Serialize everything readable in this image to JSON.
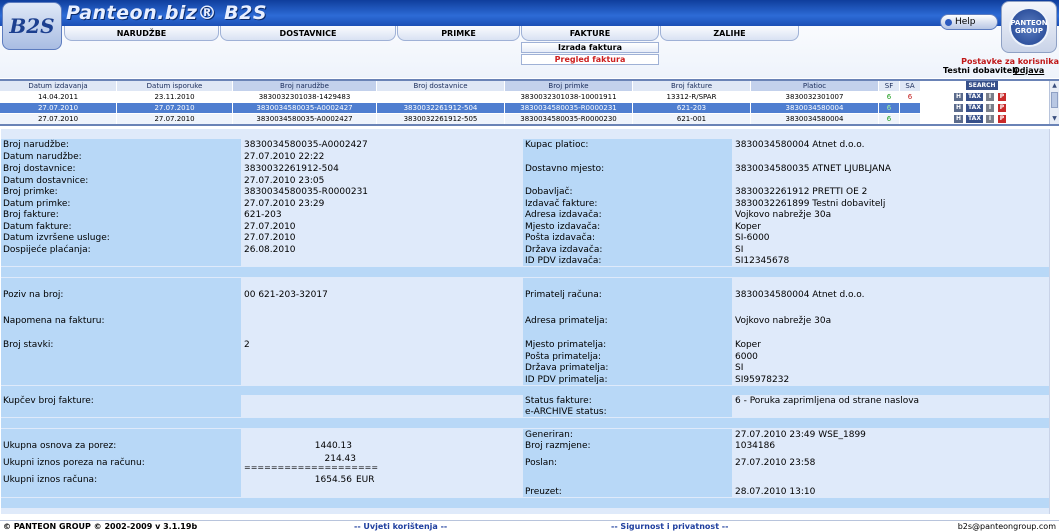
{
  "header": {
    "logo_text": "B2S",
    "brand_title": "Panteon.biz® B2S",
    "help_label": "Help",
    "panteon_logo_text": "PANTEON GROUP",
    "menu": [
      "NARUDŽBE",
      "DOSTAVNICE",
      "PRIMKE",
      "FAKTURE",
      "ZALIHE"
    ],
    "submenu": {
      "izrada": "Izrada faktura",
      "pregled": "Pregled faktura"
    },
    "postavke": "Postavke za korisnika",
    "user": "Testni dobavitelj",
    "logout": "Odjava"
  },
  "list": {
    "columns": [
      "Datum izdavanja",
      "Datum isporuke",
      "Broj narudžbe",
      "Broj dostavnice",
      "Broj primke",
      "Broj fakture",
      "Platioc",
      "SF",
      "SA"
    ],
    "search_label": "SEARCH",
    "action_labels": {
      "h": "H",
      "tax": "TAX",
      "i": "I",
      "p": "P"
    },
    "rows": [
      [
        "14.04.2011",
        "23.11.2010",
        "3830032301038-1429483",
        "",
        "3830032301038-10001911",
        "13312-R/SPAR",
        "3830032301007",
        "6",
        "6"
      ],
      [
        "27.07.2010",
        "27.07.2010",
        "3830034580035-A0002427",
        "3830032261912-504",
        "3830034580035-R0000231",
        "621-203",
        "3830034580004",
        "6",
        ""
      ],
      [
        "27.07.2010",
        "27.07.2010",
        "3830034580035-A0002427",
        "3830032261912-505",
        "3830034580035-R0000230",
        "621-001",
        "3830034580004",
        "6",
        ""
      ]
    ]
  },
  "details": {
    "left": [
      {
        "label": "Broj narudžbe:",
        "value": "3830034580035-A0002427"
      },
      {
        "label": "Datum narudžbe:",
        "value": "27.07.2010 22:22"
      },
      {
        "label": "Broj dostavnice:",
        "value": "3830032261912-504"
      },
      {
        "label": "Datum dostavnice:",
        "value": "27.07.2010 23:05"
      },
      {
        "label": "Broj primke:",
        "value": "3830034580035-R0000231"
      },
      {
        "label": "Datum primke:",
        "value": "27.07.2010 23:29"
      },
      {
        "label": "Broj fakture:",
        "value": "621-203"
      },
      {
        "label": "Datum fakture:",
        "value": "27.07.2010"
      },
      {
        "label": "Datum izvršene usluge:",
        "value": "27.07.2010"
      },
      {
        "label": "Dospijeće plaćanja:",
        "value": "26.08.2010"
      }
    ],
    "right": [
      {
        "label": "Kupac platioc:",
        "value": "3830034580004 Atnet d.o.o."
      },
      {
        "label": "Dostavno mjesto:",
        "value": "3830034580035 ATNET LJUBLJANA"
      },
      {
        "label": "Dobavljač:",
        "value": "3830032261912 PRETTI OE 2"
      },
      {
        "label": "Izdavač fakture:",
        "value": "3830032261899 Testni dobavitelj"
      },
      {
        "label": "Adresa izdavača:",
        "value": "Vojkovo nabrežje 30a"
      },
      {
        "label": "Mjesto izdavača:",
        "value": "Koper"
      },
      {
        "label": "Pošta izdavača:",
        "value": "SI-6000"
      },
      {
        "label": "Država izdavača:",
        "value": "SI"
      },
      {
        "label": "ID PDV izdavača:",
        "value": "SI12345678"
      }
    ],
    "poziv_label": "Poziv na broj:",
    "poziv_value": "00 621-203-32017",
    "napomena_label": "Napomena na fakturu:",
    "napomena_value": "",
    "broj_stavki_label": "Broj stavki:",
    "broj_stavki_value": "2",
    "primatelj": [
      {
        "label": "Primatelj računa:",
        "value": "3830034580004 Atnet d.o.o."
      },
      {
        "label": "Adresa primatelja:",
        "value": "Vojkovo nabrežje 30a"
      },
      {
        "label": "Mjesto primatelja:",
        "value": "Koper"
      },
      {
        "label": "Pošta primatelja:",
        "value": "6000"
      },
      {
        "label": "Država primatelja:",
        "value": "SI"
      },
      {
        "label": "ID PDV primatelja:",
        "value": "SI95978232"
      }
    ],
    "kupcev_label": "Kupčev broj fakture:",
    "kupcev_value": "",
    "status_label": "Status fakture:",
    "status_value": "6 - Poruka zaprimljena od strane naslova",
    "earchive_label": "e-ARCHIVE status:",
    "earchive_value": "",
    "generiran_label": "Generiran:",
    "generiran_value": "27.07.2010 23:49 WSE_1899",
    "osnova_label": "Ukupna osnova za porez:",
    "osnova_value": "1440.13",
    "razmjena_label": "Broj razmjene:",
    "razmjena_value": "1034186",
    "porez_label": "Ukupni iznos poreza na računu:",
    "porez_value": "214.43",
    "porez_line": "====================",
    "poslan_label": "Poslan:",
    "poslan_value": "27.07.2010 23:58",
    "iznos_label": "Ukupni iznos računa:",
    "iznos_value": "1654.56",
    "iznos_currency": "EUR",
    "preuzet_label": "Preuzet:",
    "preuzet_value": "28.07.2010 13:10"
  },
  "footer": {
    "copyright": "© PANTEON GROUP © 2002-2009 v 3.1.19b",
    "uvjeti": "-- Uvjeti korištenja --",
    "sigurnost": "-- Sigurnost i privatnost --",
    "email": "b2s@panteongroup.com"
  }
}
